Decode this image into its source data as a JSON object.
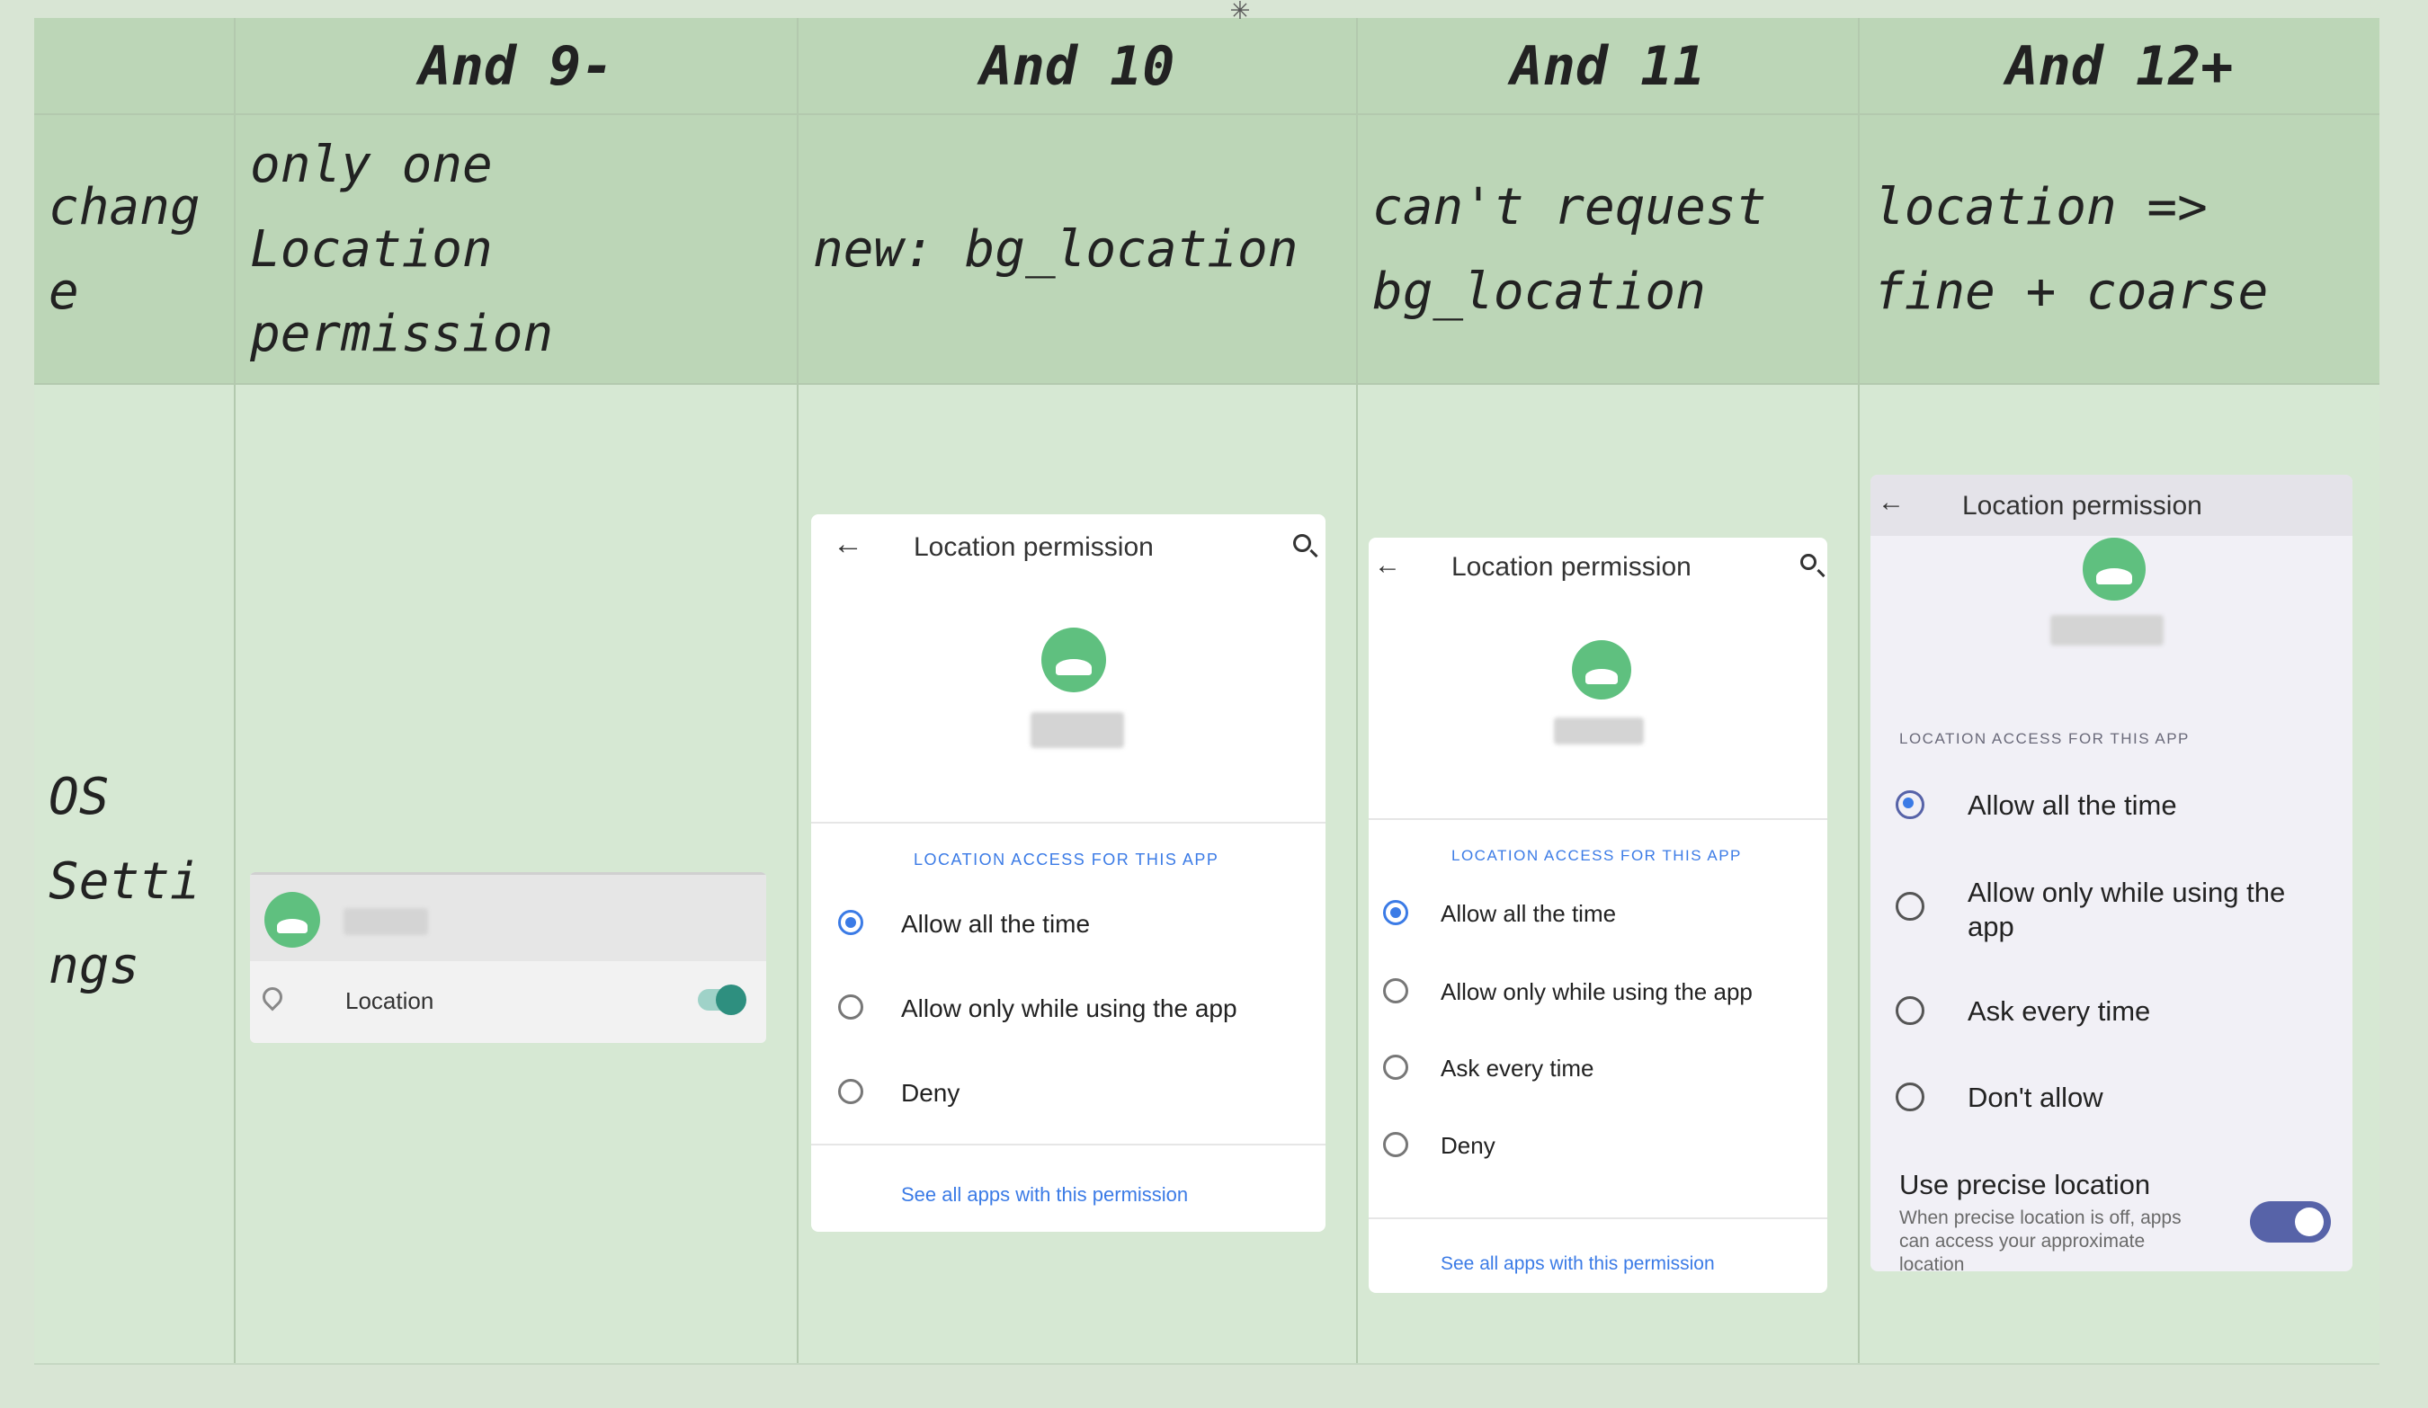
{
  "header": {
    "empty": "",
    "and9": "And 9-",
    "and10": "And 10",
    "and11": "And 11",
    "and12": "And 12+"
  },
  "changes": {
    "label": "chang\ne",
    "and9": "only one\nLocation\npermission",
    "and10": "new: bg_location",
    "and11": "can't request\nbg_location",
    "and12": "location =>\nfine + coarse"
  },
  "os_settings": {
    "label": "OS\nSetti\nngs"
  },
  "screen9": {
    "location_label": "Location",
    "toggle_on": true
  },
  "screen10": {
    "title": "Location permission",
    "section": "LOCATION ACCESS FOR THIS APP",
    "options": [
      "Allow all the time",
      "Allow only while using the app",
      "Deny"
    ],
    "selected": 0,
    "link": "See all apps with this permission"
  },
  "screen11": {
    "title": "Location permission",
    "section": "LOCATION ACCESS FOR THIS APP",
    "options": [
      "Allow all the time",
      "Allow only while using the app",
      "Ask every time",
      "Deny"
    ],
    "selected": 0,
    "link": "See all apps with this permission"
  },
  "screen12": {
    "title": "Location permission",
    "section": "LOCATION ACCESS FOR THIS APP",
    "options": [
      "Allow all the time",
      "Allow only while using the\napp",
      "Ask every time",
      "Don't allow"
    ],
    "selected": 0,
    "precise_title": "Use precise location",
    "precise_desc": "When precise location is off, apps\ncan access your approximate\nlocation",
    "precise_on": true
  }
}
